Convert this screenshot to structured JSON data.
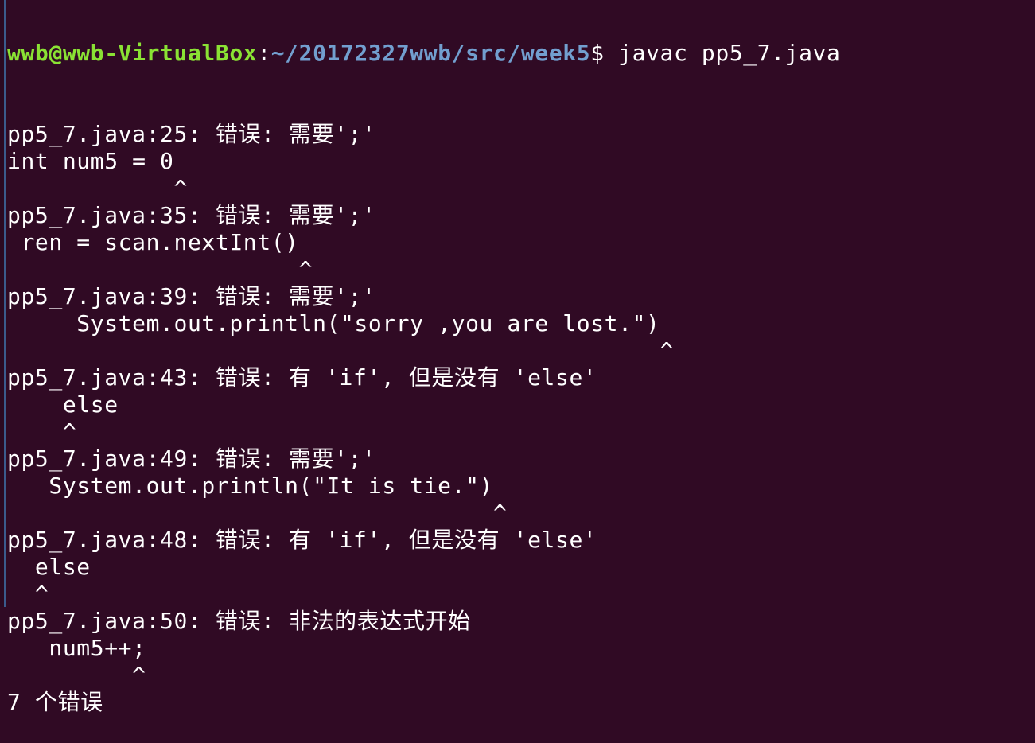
{
  "prompt": {
    "user_host": "wwb@wwb-VirtualBox",
    "separator": ":",
    "path": "~/20172327wwb/src/week5",
    "symbol": "$ ",
    "command": "javac pp5_7.java"
  },
  "output_lines": [
    "pp5_7.java:25: 错误: 需要';'",
    "int num5 = 0",
    "            ^",
    "pp5_7.java:35: 错误: 需要';'",
    " ren = scan.nextInt()",
    "                     ^",
    "pp5_7.java:39: 错误: 需要';'",
    "     System.out.println(\"sorry ,you are lost.\")",
    "                                               ^",
    "pp5_7.java:43: 错误: 有 'if', 但是没有 'else'",
    "    else",
    "    ^",
    "pp5_7.java:49: 错误: 需要';'",
    "   System.out.println(\"It is tie.\")",
    "                                   ^",
    "pp5_7.java:48: 错误: 有 'if', 但是没有 'else'",
    "  else",
    "  ^",
    "pp5_7.java:50: 错误: 非法的表达式开始",
    "   num5++;",
    "         ^",
    "7 个错误"
  ],
  "colors": {
    "background": "#300a24",
    "user": "#8ae234",
    "path": "#729fcf",
    "text": "#ffffff"
  }
}
